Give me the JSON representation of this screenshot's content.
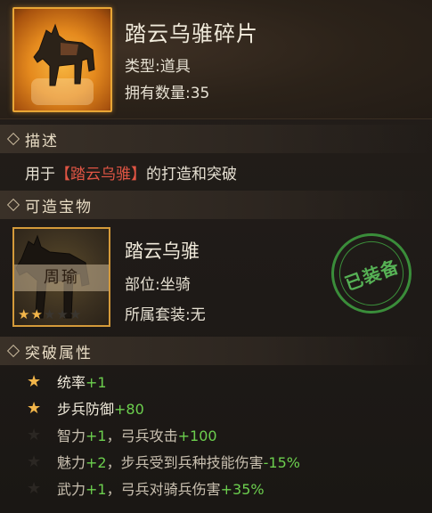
{
  "item": {
    "name": "踏云乌骓碎片",
    "type_label": "类型:",
    "type_value": "道具",
    "count_label": "拥有数量:",
    "count_value": "35",
    "icon": "horse-fragment-icon"
  },
  "description_section": {
    "header": "描述",
    "text_prefix": "用于",
    "text_link": "【踏云乌骓】",
    "text_suffix": "的打造和突破"
  },
  "treasure_section": {
    "header": "可造宝物",
    "name": "踏云乌骓",
    "owner": "周瑜",
    "slot_label": "部位:",
    "slot_value": "坐骑",
    "set_label": "所属套装:",
    "set_value": "无",
    "stars_lit": 2,
    "stars_total": 5,
    "badge": "已装备",
    "badge_color": "#3e9a3e"
  },
  "breakthrough_section": {
    "header": "突破属性",
    "rows": [
      {
        "active": true,
        "parts": [
          {
            "t": "统率",
            "c": "name"
          },
          {
            "t": "+1",
            "c": "bonus"
          }
        ]
      },
      {
        "active": true,
        "parts": [
          {
            "t": "步兵防御",
            "c": "name"
          },
          {
            "t": "+80",
            "c": "bonus"
          }
        ]
      },
      {
        "active": false,
        "parts": [
          {
            "t": "智力",
            "c": "name"
          },
          {
            "t": "+1",
            "c": "bonus"
          },
          {
            "t": "，弓兵攻击",
            "c": "sep"
          },
          {
            "t": "+100",
            "c": "bonus"
          }
        ]
      },
      {
        "active": false,
        "parts": [
          {
            "t": "魅力",
            "c": "name"
          },
          {
            "t": "+2",
            "c": "bonus"
          },
          {
            "t": "，步兵受到兵种技能伤害",
            "c": "sep"
          },
          {
            "t": "-15%",
            "c": "bonus"
          }
        ]
      },
      {
        "active": false,
        "parts": [
          {
            "t": "武力",
            "c": "name"
          },
          {
            "t": "+1",
            "c": "bonus"
          },
          {
            "t": "，弓兵对骑兵伤害",
            "c": "sep"
          },
          {
            "t": "+35%",
            "c": "bonus"
          }
        ]
      }
    ]
  },
  "colors": {
    "accent_gold": "#e8a636",
    "bonus_green": "#6ccf4e",
    "link_red": "#e05544",
    "star_gold": "#f3b64a"
  }
}
